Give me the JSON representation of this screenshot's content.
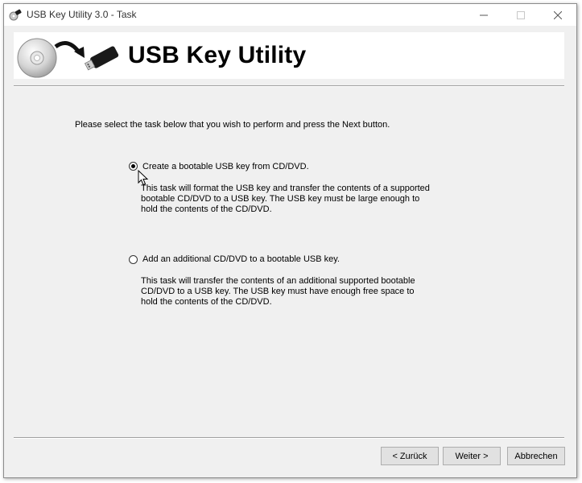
{
  "window": {
    "title": "USB Key Utility 3.0 - Task"
  },
  "header": {
    "title": "USB Key Utility"
  },
  "instructions": "Please select the task below that you wish to perform and press the Next button.",
  "options": [
    {
      "label": "Create a bootable USB key from CD/DVD.",
      "selected": true,
      "description": "This task will format the USB key and transfer the contents of a supported bootable CD/DVD to a USB key.  The USB key must be large enough to hold the contents of the CD/DVD."
    },
    {
      "label": "Add an additional CD/DVD to a bootable USB key.",
      "selected": false,
      "description": "This task will transfer the contents of an additional supported bootable CD/DVD to a USB key.  The USB key must have enough free space to hold the contents of the CD/DVD."
    }
  ],
  "buttons": {
    "back": "< Zurück",
    "next": "Weiter >",
    "cancel": "Abbrechen"
  },
  "icons": {
    "app": "usb-key-app-icon",
    "header": "cd-to-usb-icon"
  }
}
